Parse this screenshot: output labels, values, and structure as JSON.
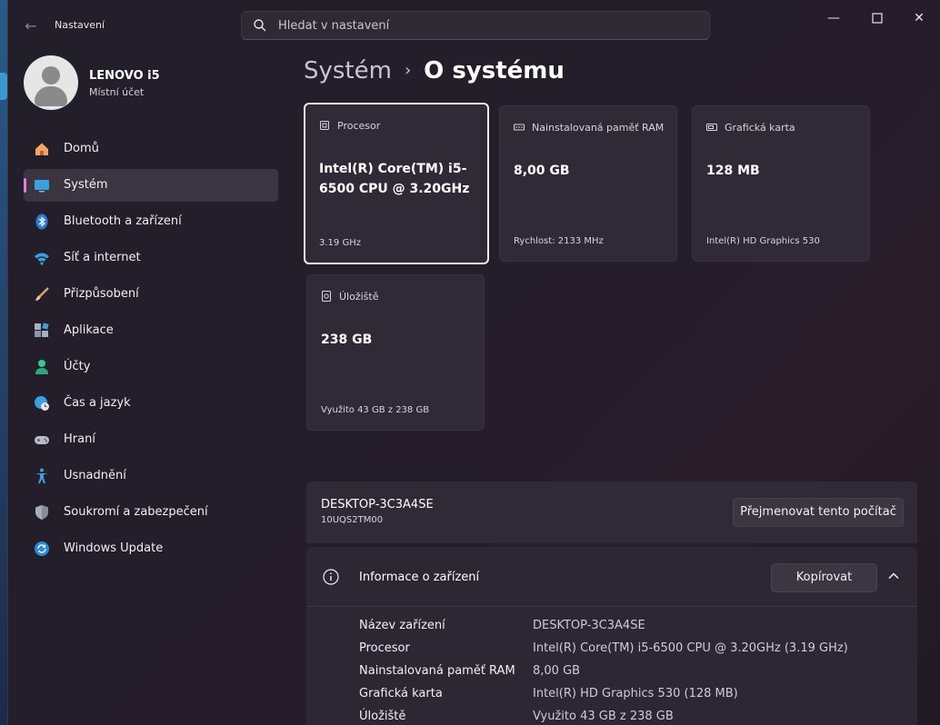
{
  "app": {
    "title": "Nastavení"
  },
  "search": {
    "placeholder": "Hledat v nastavení"
  },
  "profile": {
    "name": "LENOVO i5",
    "account_type": "Místní účet"
  },
  "sidebar": {
    "items": [
      {
        "label": "Domů",
        "icon": "home-icon",
        "active": false
      },
      {
        "label": "Systém",
        "icon": "monitor-icon",
        "active": true
      },
      {
        "label": "Bluetooth a zařízení",
        "icon": "bluetooth-icon",
        "active": false
      },
      {
        "label": "Síť a internet",
        "icon": "wifi-icon",
        "active": false
      },
      {
        "label": "Přizpůsobení",
        "icon": "brush-icon",
        "active": false
      },
      {
        "label": "Aplikace",
        "icon": "apps-icon",
        "active": false
      },
      {
        "label": "Účty",
        "icon": "person-icon",
        "active": false
      },
      {
        "label": "Čas a jazyk",
        "icon": "globe-clock-icon",
        "active": false
      },
      {
        "label": "Hraní",
        "icon": "gamepad-icon",
        "active": false
      },
      {
        "label": "Usnadnění",
        "icon": "accessibility-icon",
        "active": false
      },
      {
        "label": "Soukromí a zabezpečení",
        "icon": "shield-icon",
        "active": false
      },
      {
        "label": "Windows Update",
        "icon": "update-icon",
        "active": false
      }
    ]
  },
  "breadcrumb": {
    "parent": "Systém",
    "separator": "›",
    "current": "O systému"
  },
  "cards": {
    "cpu": {
      "title": "Procesor",
      "value": "Intel(R) Core(TM) i5-6500 CPU @ 3.20GHz",
      "sub": "3.19 GHz"
    },
    "ram": {
      "title": "Nainstalovaná paměť RAM",
      "value": "8,00 GB",
      "sub": "Rychlost: 2133 MHz"
    },
    "gpu": {
      "title": "Grafická karta",
      "value": "128 MB",
      "sub": "Intel(R) HD Graphics 530"
    },
    "storage": {
      "title": "Úložiště",
      "value": "238 GB",
      "sub": "Využito 43 GB z 238 GB"
    }
  },
  "device": {
    "name": "DESKTOP-3C3A4SE",
    "model": "10UQS2TM00",
    "rename_label": "Přejmenovat tento počítač"
  },
  "info": {
    "title": "Informace o zařízení",
    "copy_label": "Kopírovat",
    "specs": [
      {
        "key": "Název zařízení",
        "value": "DESKTOP-3C3A4SE"
      },
      {
        "key": "Procesor",
        "value": "Intel(R) Core(TM) i5-6500 CPU @ 3.20GHz (3.19 GHz)"
      },
      {
        "key": "Nainstalovaná paměť RAM",
        "value": "8,00 GB"
      },
      {
        "key": "Grafická karta",
        "value": "Intel(R) HD Graphics 530 (128 MB)"
      },
      {
        "key": "Úložiště",
        "value": "Využito 43 GB z 238 GB"
      }
    ]
  },
  "colors": {
    "accent": "#e87be0",
    "background": "#221f2a",
    "card": "#2f2a35"
  }
}
